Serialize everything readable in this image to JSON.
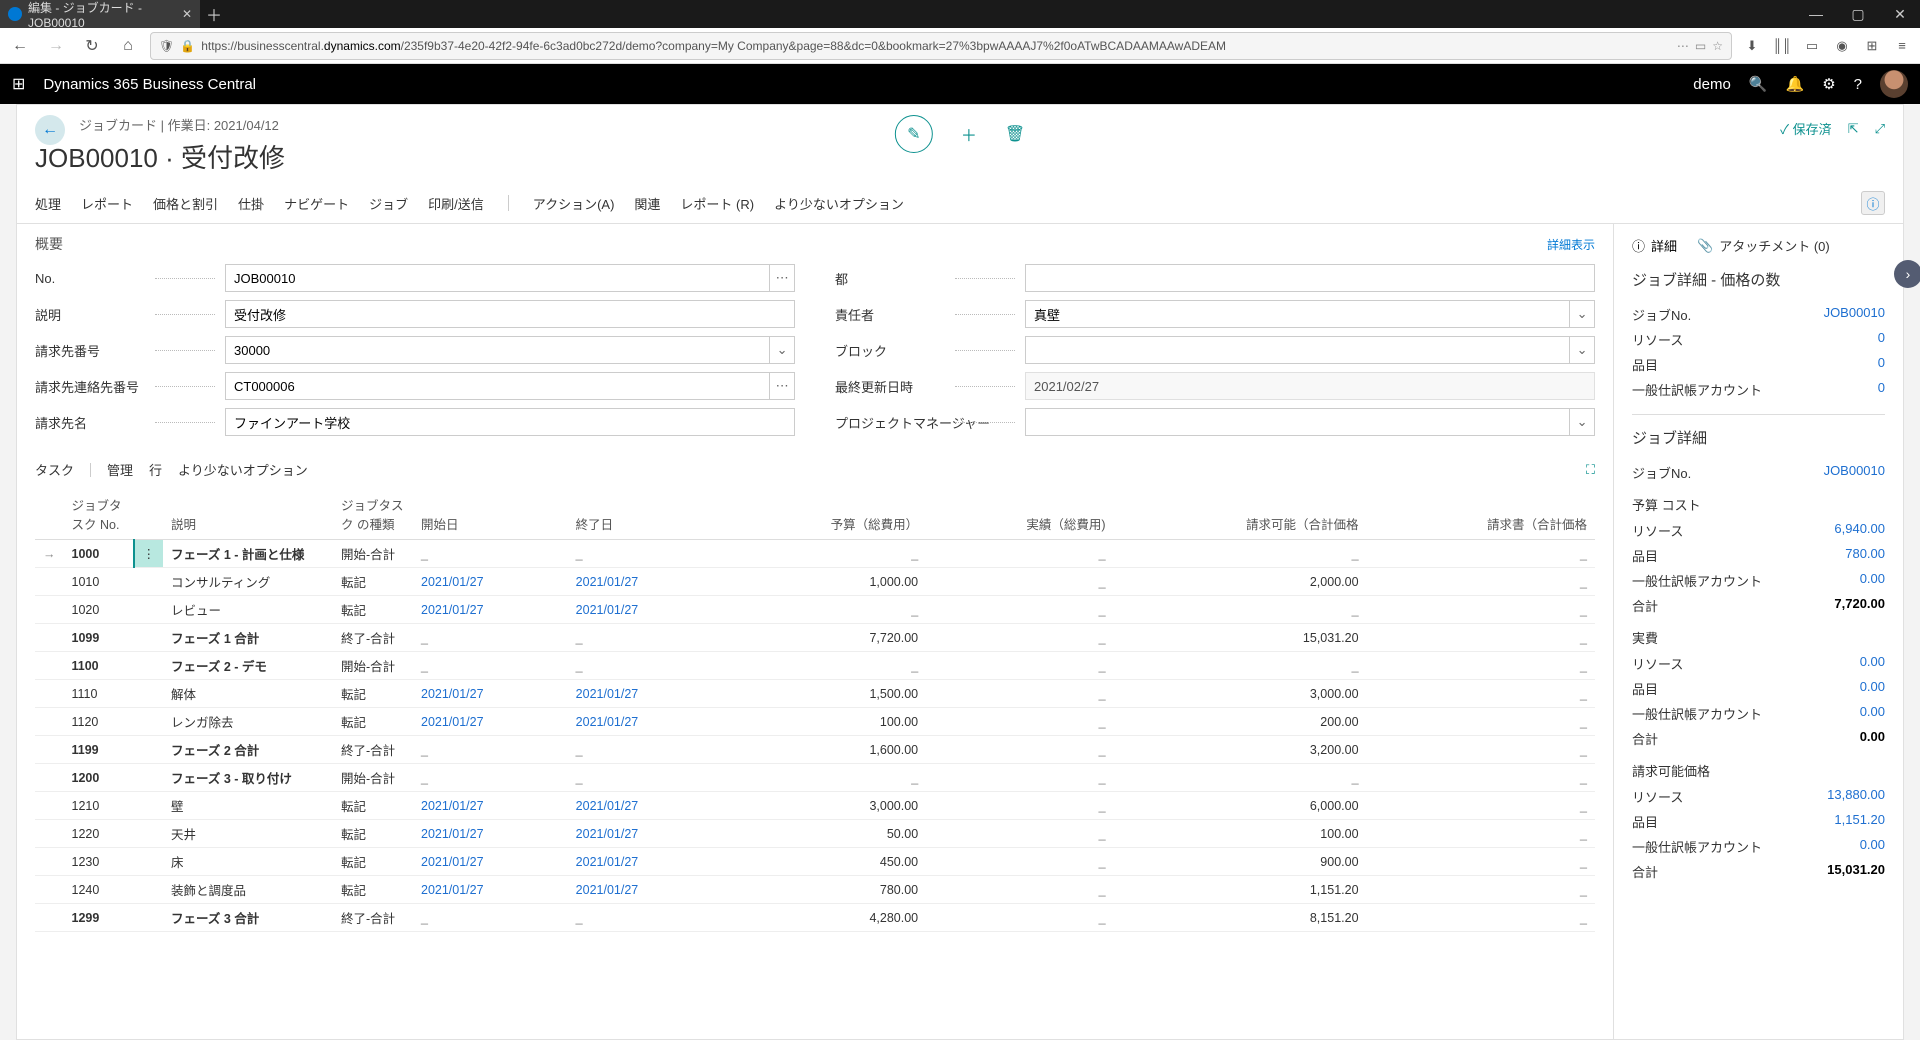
{
  "browser": {
    "tab_title": "編集 - ジョブカード - JOB00010",
    "url_prefix": "https://businesscentral.",
    "url_domain": "dynamics.com",
    "url_path": "/235f9b37-4e20-42f2-94fe-6c3ad0bc272d/demo?company=My Company&page=88&dc=0&bookmark=27%3bpwAAAAJ7%2f0oATwBCADAAMAAwADEAM"
  },
  "header": {
    "brand": "Dynamics 365 Business Central",
    "user": "demo"
  },
  "page": {
    "breadcrumb": "ジョブカード | 作業日: 2021/04/12",
    "title": "JOB00010 · 受付改修",
    "saved": "保存済"
  },
  "actions": {
    "process": "処理",
    "report": "レポート",
    "price_discount": "価格と割引",
    "wip": "仕掛",
    "navigate": "ナビゲート",
    "job": "ジョブ",
    "print_send": "印刷/送信",
    "actions_a": "アクション(A)",
    "related": "関連",
    "report_r": "レポート (R)",
    "fewer": "より少ないオプション"
  },
  "overview": {
    "section": "概要",
    "show_more": "詳細表示",
    "fields": {
      "no_label": "No.",
      "no_value": "JOB00010",
      "desc_label": "説明",
      "desc_value": "受付改修",
      "billto_label": "請求先番号",
      "billto_value": "30000",
      "contact_label": "請求先連絡先番号",
      "contact_value": "CT000006",
      "billname_label": "請求先名",
      "billname_value": "ファインアート学校",
      "city_label": "都",
      "city_value": "",
      "responsible_label": "責任者",
      "responsible_value": "真壁",
      "block_label": "ブロック",
      "block_value": "",
      "modified_label": "最終更新日時",
      "modified_value": "2021/02/27",
      "pm_label": "プロジェクトマネージャー",
      "pm_value": ""
    }
  },
  "tasks": {
    "section": "タスク",
    "manage": "管理",
    "line": "行",
    "fewer": "より少ないオプション",
    "cols": {
      "taskno": "ジョブタスク\nNo.",
      "desc": "説明",
      "type": "ジョブタスク\nの種類",
      "start": "開始日",
      "end": "終了日",
      "budget": "予算（総費用）",
      "actual": "実績（総費用)",
      "billable": "請求可能（合計価格",
      "invoice": "請求書（合計価格"
    },
    "rows": [
      {
        "no": "1000",
        "desc": "フェーズ 1 - 計画と仕様",
        "type": "開始-合計",
        "start": "_",
        "end": "_",
        "budget": "_",
        "actual": "_",
        "billable": "_",
        "invoice": "_",
        "bold": true,
        "sel": true
      },
      {
        "no": "1010",
        "desc": "コンサルティング",
        "type": "転記",
        "start": "2021/01/27",
        "end": "2021/01/27",
        "budget": "1,000.00",
        "actual": "_",
        "billable": "2,000.00",
        "invoice": "_"
      },
      {
        "no": "1020",
        "desc": "レビュー",
        "type": "転記",
        "start": "2021/01/27",
        "end": "2021/01/27",
        "budget": "_",
        "actual": "_",
        "billable": "_",
        "invoice": "_"
      },
      {
        "no": "1099",
        "desc": "フェーズ 1 合計",
        "type": "終了-合計",
        "start": "_",
        "end": "_",
        "budget": "7,720.00",
        "actual": "_",
        "billable": "15,031.20",
        "invoice": "_",
        "bold": true
      },
      {
        "no": "1100",
        "desc": "フェーズ 2 - デモ",
        "type": "開始-合計",
        "start": "_",
        "end": "_",
        "budget": "_",
        "actual": "_",
        "billable": "_",
        "invoice": "_",
        "bold": true
      },
      {
        "no": "1110",
        "desc": "解体",
        "type": "転記",
        "start": "2021/01/27",
        "end": "2021/01/27",
        "budget": "1,500.00",
        "actual": "_",
        "billable": "3,000.00",
        "invoice": "_"
      },
      {
        "no": "1120",
        "desc": "レンガ除去",
        "type": "転記",
        "start": "2021/01/27",
        "end": "2021/01/27",
        "budget": "100.00",
        "actual": "_",
        "billable": "200.00",
        "invoice": "_"
      },
      {
        "no": "1199",
        "desc": "フェーズ 2 合計",
        "type": "終了-合計",
        "start": "_",
        "end": "_",
        "budget": "1,600.00",
        "actual": "_",
        "billable": "3,200.00",
        "invoice": "_",
        "bold": true
      },
      {
        "no": "1200",
        "desc": "フェーズ 3 - 取り付け",
        "type": "開始-合計",
        "start": "_",
        "end": "_",
        "budget": "_",
        "actual": "_",
        "billable": "_",
        "invoice": "_",
        "bold": true
      },
      {
        "no": "1210",
        "desc": "壁",
        "type": "転記",
        "start": "2021/01/27",
        "end": "2021/01/27",
        "budget": "3,000.00",
        "actual": "_",
        "billable": "6,000.00",
        "invoice": "_"
      },
      {
        "no": "1220",
        "desc": "天井",
        "type": "転記",
        "start": "2021/01/27",
        "end": "2021/01/27",
        "budget": "50.00",
        "actual": "_",
        "billable": "100.00",
        "invoice": "_"
      },
      {
        "no": "1230",
        "desc": "床",
        "type": "転記",
        "start": "2021/01/27",
        "end": "2021/01/27",
        "budget": "450.00",
        "actual": "_",
        "billable": "900.00",
        "invoice": "_"
      },
      {
        "no": "1240",
        "desc": "装飾と調度品",
        "type": "転記",
        "start": "2021/01/27",
        "end": "2021/01/27",
        "budget": "780.00",
        "actual": "_",
        "billable": "1,151.20",
        "invoice": "_"
      },
      {
        "no": "1299",
        "desc": "フェーズ 3 合計",
        "type": "終了-合計",
        "start": "_",
        "end": "_",
        "budget": "4,280.00",
        "actual": "_",
        "billable": "8,151.20",
        "invoice": "_",
        "bold": true
      }
    ]
  },
  "factbox": {
    "details": "詳細",
    "attachments": "アタッチメント (0)",
    "sec1_title": "ジョブ詳細 - 価格の数",
    "sec1": {
      "jobno_l": "ジョブNo.",
      "jobno_v": "JOB00010",
      "resource_l": "リソース",
      "resource_v": "0",
      "item_l": "品目",
      "item_v": "0",
      "gl_l": "一般仕訳帳アカウント",
      "gl_v": "0"
    },
    "sec2_title": "ジョブ詳細",
    "sec2_jobno_l": "ジョブNo.",
    "sec2_jobno_v": "JOB00010",
    "budget_title": "予算 コスト",
    "budget": {
      "resource_l": "リソース",
      "resource_v": "6,940.00",
      "item_l": "品目",
      "item_v": "780.00",
      "gl_l": "一般仕訳帳アカウント",
      "gl_v": "0.00",
      "total_l": "合計",
      "total_v": "7,720.00"
    },
    "actual_title": "実費",
    "actual": {
      "resource_l": "リソース",
      "resource_v": "0.00",
      "item_l": "品目",
      "item_v": "0.00",
      "gl_l": "一般仕訳帳アカウント",
      "gl_v": "0.00",
      "total_l": "合計",
      "total_v": "0.00"
    },
    "billable_title": "請求可能価格",
    "billable": {
      "resource_l": "リソース",
      "resource_v": "13,880.00",
      "item_l": "品目",
      "item_v": "1,151.20",
      "gl_l": "一般仕訳帳アカウント",
      "gl_v": "0.00",
      "total_l": "合計",
      "total_v": "15,031.20"
    }
  }
}
